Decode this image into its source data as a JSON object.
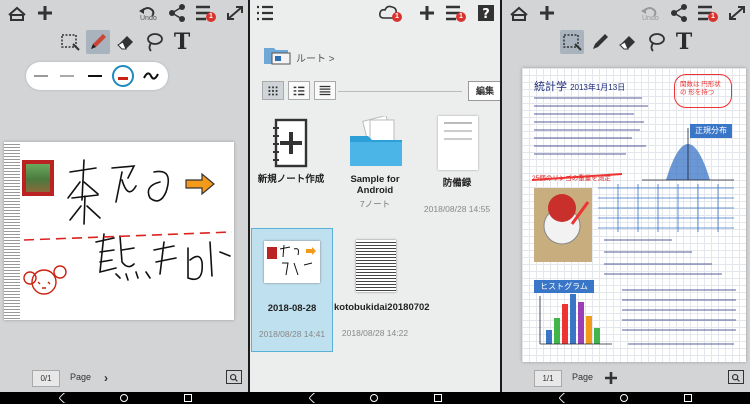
{
  "left_panel": {
    "toolbar_undo_label": "Undo",
    "notification_count": "1",
    "page_value": "0/1",
    "page_label": "Page"
  },
  "middle_panel": {
    "notification_count": "1",
    "breadcrumb": "ルート >",
    "edit_label": "編集",
    "items": [
      {
        "name": "新規ノート作成",
        "sub": "",
        "date": ""
      },
      {
        "name": "Sample for Android",
        "sub": "7ノート",
        "date": ""
      },
      {
        "name": "防備録",
        "sub": "",
        "date": "2018/08/28 14:55"
      },
      {
        "name": "2018-08-28",
        "sub": "",
        "date": "2018/08/28 14:41"
      },
      {
        "name": "kotobukidai20180702",
        "sub": "",
        "date": "2018/08/28 14:22"
      }
    ]
  },
  "right_panel": {
    "toolbar_undo_label": "Undo",
    "notification_count": "1",
    "page_value": "1/1",
    "page_label": "Page",
    "note_title": "統計学",
    "note_date": "2013年1月13日",
    "note_heading_normal": "正規分布",
    "note_heading_hist": "ヒストグラム",
    "note_bubble": "関数は 円形状の 形を持つ",
    "note_dice": "25個のリンゴの重量を測定"
  },
  "colors": {
    "accent": "#1f8ac0",
    "badge": "#d8342f",
    "note_blue": "#3a76c7"
  },
  "icons": [
    "notebook-back-icon",
    "plus-icon",
    "undo-icon",
    "share-icon",
    "menu-icon",
    "fullscreen-icon",
    "cloud-icon",
    "help-icon",
    "lasso-select-icon",
    "pen-icon",
    "eraser-icon",
    "lasso-icon",
    "text-tool-icon",
    "zoom-icon",
    "grid-view-icon",
    "list-view-icon",
    "detail-view-icon"
  ]
}
